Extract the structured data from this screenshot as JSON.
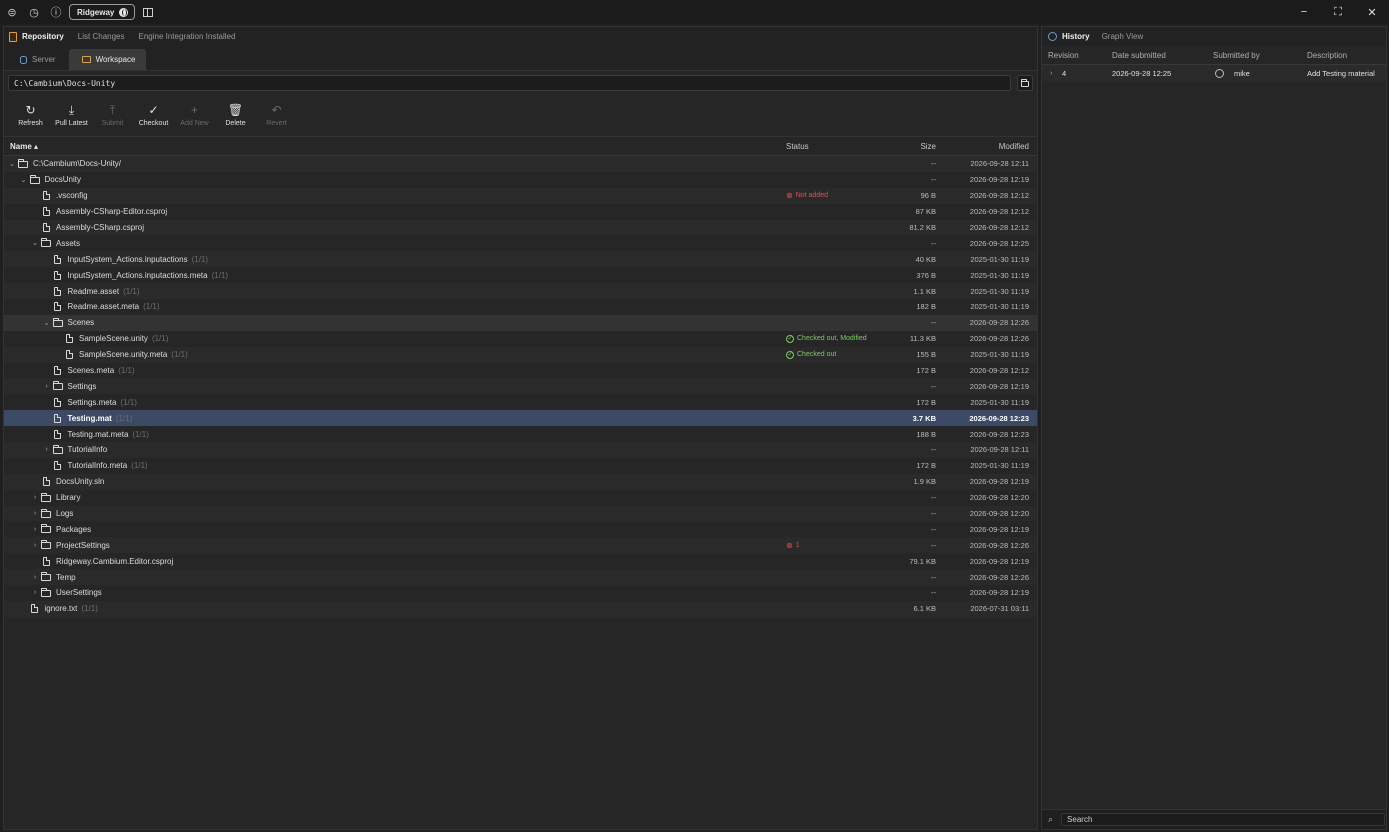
{
  "titlebar": {
    "workspace_pill": "Ridgeway",
    "icons": [
      "help-circle-icon",
      "history-icon",
      "question-icon"
    ],
    "window_controls": {
      "minimize": "−",
      "maximize": "⛶",
      "close": "✕"
    }
  },
  "left": {
    "repo_tabs": [
      {
        "label": "Repository",
        "active": true
      },
      {
        "label": "List Changes",
        "active": false
      },
      {
        "label": "Engine Integration Installed",
        "active": false
      }
    ],
    "sub_tabs": [
      {
        "label": "Server",
        "active": false
      },
      {
        "label": "Workspace",
        "active": true
      }
    ],
    "path_value": "C:\\Cambium\\Docs-Unity",
    "toolbar": [
      {
        "label": "Refresh",
        "icon": "refresh-icon",
        "glyph": "↻",
        "enabled": true
      },
      {
        "label": "Pull Latest",
        "icon": "download-icon",
        "glyph": "⤓",
        "enabled": true
      },
      {
        "label": "Submit",
        "icon": "upload-icon",
        "glyph": "⤒",
        "enabled": false
      },
      {
        "label": "Checkout",
        "icon": "check-icon",
        "glyph": "✓",
        "enabled": true
      },
      {
        "label": "Add New",
        "icon": "plus-icon",
        "glyph": "+",
        "enabled": false
      },
      {
        "label": "Delete",
        "icon": "trash-icon",
        "glyph": "🗑",
        "enabled": true
      },
      {
        "label": "Revert",
        "icon": "undo-icon",
        "glyph": "↶",
        "enabled": false
      }
    ],
    "columns": {
      "name": "Name ▴",
      "status": "Status",
      "size": "Size",
      "modified": "Modified"
    },
    "rows": [
      {
        "depth": 0,
        "type": "folder",
        "expanded": true,
        "name": "C:\\Cambium\\Docs-Unity/",
        "meta": "",
        "status": "",
        "status_kind": "",
        "size": "--",
        "modified": "2026-09-28 12:11"
      },
      {
        "depth": 1,
        "type": "folder",
        "expanded": true,
        "name": "DocsUnity",
        "meta": "",
        "status": "",
        "status_kind": "",
        "size": "--",
        "modified": "2026-09-28 12:19"
      },
      {
        "depth": 2,
        "type": "file",
        "name": ".vsconfig",
        "meta": "",
        "status": "Not added",
        "status_kind": "red",
        "size": "96 B",
        "modified": "2026-09-28 12:12"
      },
      {
        "depth": 2,
        "type": "file",
        "name": "Assembly-CSharp-Editor.csproj",
        "meta": "",
        "status": "",
        "status_kind": "",
        "size": "87 KB",
        "modified": "2026-09-28 12:12"
      },
      {
        "depth": 2,
        "type": "file",
        "name": "Assembly-CSharp.csproj",
        "meta": "",
        "status": "",
        "status_kind": "",
        "size": "81.2 KB",
        "modified": "2026-09-28 12:12"
      },
      {
        "depth": 2,
        "type": "folder",
        "expanded": true,
        "name": "Assets",
        "meta": "",
        "status": "",
        "status_kind": "",
        "size": "--",
        "modified": "2026-09-28 12:25"
      },
      {
        "depth": 3,
        "type": "file",
        "name": "InputSystem_Actions.inputactions",
        "meta": "(1/1)",
        "status": "",
        "status_kind": "",
        "size": "40 KB",
        "modified": "2025-01-30 11:19"
      },
      {
        "depth": 3,
        "type": "file",
        "name": "InputSystem_Actions.inputactions.meta",
        "meta": "(1/1)",
        "status": "",
        "status_kind": "",
        "size": "376 B",
        "modified": "2025-01-30 11:19"
      },
      {
        "depth": 3,
        "type": "file",
        "name": "Readme.asset",
        "meta": "(1/1)",
        "status": "",
        "status_kind": "",
        "size": "1.1 KB",
        "modified": "2025-01-30 11:19"
      },
      {
        "depth": 3,
        "type": "file",
        "name": "Readme.asset.meta",
        "meta": "(1/1)",
        "status": "",
        "status_kind": "",
        "size": "182 B",
        "modified": "2025-01-30 11:19"
      },
      {
        "depth": 3,
        "type": "folder",
        "expanded": true,
        "name": "Scenes",
        "meta": "",
        "status": "",
        "status_kind": "",
        "size": "--",
        "modified": "2026-09-28 12:26",
        "hovered": true
      },
      {
        "depth": 4,
        "type": "file",
        "name": "SampleScene.unity",
        "meta": "(1/1)",
        "status": "Checked out, Modified",
        "status_kind": "green",
        "size": "11.3 KB",
        "modified": "2026-09-28 12:26"
      },
      {
        "depth": 4,
        "type": "file",
        "name": "SampleScene.unity.meta",
        "meta": "(1/1)",
        "status": "Checked out",
        "status_kind": "green",
        "size": "155 B",
        "modified": "2025-01-30 11:19"
      },
      {
        "depth": 3,
        "type": "file",
        "name": "Scenes.meta",
        "meta": "(1/1)",
        "status": "",
        "status_kind": "",
        "size": "172 B",
        "modified": "2026-09-28 12:12"
      },
      {
        "depth": 3,
        "type": "folder",
        "expanded": false,
        "name": "Settings",
        "meta": "",
        "status": "",
        "status_kind": "",
        "size": "--",
        "modified": "2026-09-28 12:19"
      },
      {
        "depth": 3,
        "type": "file",
        "name": "Settings.meta",
        "meta": "(1/1)",
        "status": "",
        "status_kind": "",
        "size": "172 B",
        "modified": "2025-01-30 11:19"
      },
      {
        "depth": 3,
        "type": "file",
        "name": "Testing.mat",
        "meta": "(1/1)",
        "status": "",
        "status_kind": "",
        "size": "3.7 KB",
        "modified": "2026-09-28 12:23",
        "selected": true
      },
      {
        "depth": 3,
        "type": "file",
        "name": "Testing.mat.meta",
        "meta": "(1/1)",
        "status": "",
        "status_kind": "",
        "size": "188 B",
        "modified": "2026-09-28 12:23"
      },
      {
        "depth": 3,
        "type": "folder",
        "expanded": false,
        "name": "TutorialInfo",
        "meta": "",
        "status": "",
        "status_kind": "",
        "size": "--",
        "modified": "2026-09-28 12:11"
      },
      {
        "depth": 3,
        "type": "file",
        "name": "TutorialInfo.meta",
        "meta": "(1/1)",
        "status": "",
        "status_kind": "",
        "size": "172 B",
        "modified": "2025-01-30 11:19"
      },
      {
        "depth": 2,
        "type": "file",
        "name": "DocsUnity.sln",
        "meta": "",
        "status": "",
        "status_kind": "",
        "size": "1.9 KB",
        "modified": "2026-09-28 12:19"
      },
      {
        "depth": 2,
        "type": "folder",
        "expanded": false,
        "name": "Library",
        "meta": "",
        "status": "",
        "status_kind": "",
        "size": "--",
        "modified": "2026-09-28 12:20"
      },
      {
        "depth": 2,
        "type": "folder",
        "expanded": false,
        "name": "Logs",
        "meta": "",
        "status": "",
        "status_kind": "",
        "size": "--",
        "modified": "2026-09-28 12:20"
      },
      {
        "depth": 2,
        "type": "folder",
        "expanded": false,
        "name": "Packages",
        "meta": "",
        "status": "",
        "status_kind": "",
        "size": "--",
        "modified": "2026-09-28 12:19"
      },
      {
        "depth": 2,
        "type": "folder",
        "expanded": false,
        "name": "ProjectSettings",
        "meta": "",
        "status": "1",
        "status_kind": "red",
        "size": "--",
        "modified": "2026-09-28 12:26"
      },
      {
        "depth": 2,
        "type": "file",
        "name": "Ridgeway.Cambium.Editor.csproj",
        "meta": "",
        "status": "",
        "status_kind": "",
        "size": "79.1 KB",
        "modified": "2026-09-28 12:19"
      },
      {
        "depth": 2,
        "type": "folder",
        "expanded": false,
        "name": "Temp",
        "meta": "",
        "status": "",
        "status_kind": "",
        "size": "--",
        "modified": "2026-09-28 12:26"
      },
      {
        "depth": 2,
        "type": "folder",
        "expanded": false,
        "name": "UserSettings",
        "meta": "",
        "status": "",
        "status_kind": "",
        "size": "--",
        "modified": "2026-09-28 12:19"
      },
      {
        "depth": 1,
        "type": "file",
        "name": "ignore.txt",
        "meta": "(1/1)",
        "status": "",
        "status_kind": "",
        "size": "6.1 KB",
        "modified": "2026-07-31 03:11"
      }
    ]
  },
  "right": {
    "tabs": [
      {
        "label": "History",
        "active": true
      },
      {
        "label": "Graph View",
        "active": false
      }
    ],
    "columns": {
      "revision": "Revision",
      "date": "Date submitted",
      "user": "Submitted by",
      "description": "Description"
    },
    "rows": [
      {
        "revision": "4",
        "date": "2026-09-28 12:25",
        "user": "mike",
        "description": "Add Testing material"
      }
    ],
    "search_placeholder": "Search"
  },
  "colors": {
    "selected_row": "#3c4a66",
    "status_red": "#e05050",
    "status_green": "#7fc86a",
    "folder_accent": "#d6a24a"
  }
}
